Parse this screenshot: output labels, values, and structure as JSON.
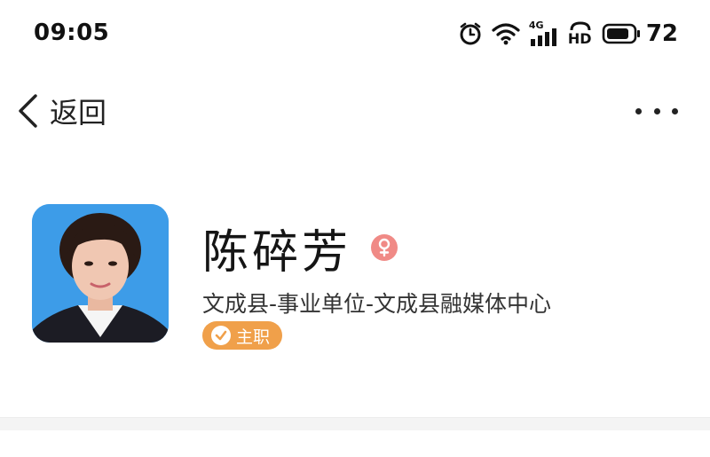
{
  "status_bar": {
    "time": "09:05",
    "network": "4G",
    "hd": "HD",
    "battery": "72",
    "icons": [
      "alarm-icon",
      "wifi-icon",
      "signal-4g-icon",
      "hd-voice-icon",
      "battery-icon"
    ]
  },
  "nav": {
    "back_label": "返回",
    "back_icon": "chevron-left-icon",
    "more_icon": "more-horizontal-icon"
  },
  "profile": {
    "name": "陈碎芳",
    "gender_icon": "female-icon",
    "organization": "文成县-事业单位-文成县融媒体中心",
    "role_badge": "主职",
    "colors": {
      "avatar_bg": "#3d9ce8",
      "gender_badge": "#f08a86",
      "role_badge": "#f0a04a"
    }
  }
}
